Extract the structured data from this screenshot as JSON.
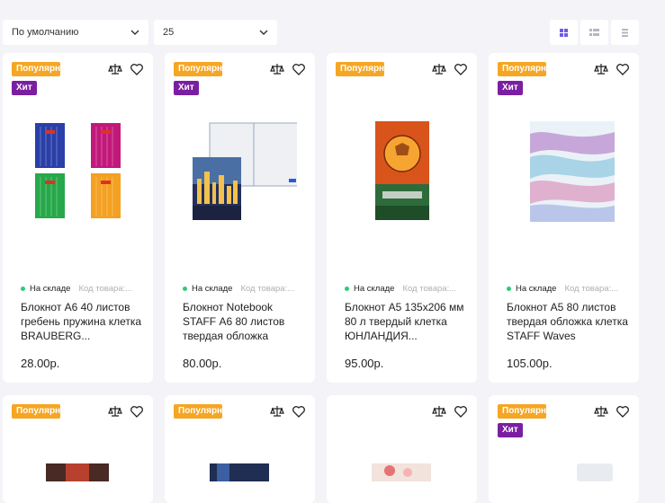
{
  "toolbar": {
    "sort_value": "По умолчанию",
    "perpage_value": "25"
  },
  "view_modes": [
    "grid-icon",
    "list-icon",
    "compact-list-icon"
  ],
  "colors": {
    "popular": "#f5a623",
    "hit": "#7b1fa2",
    "in_stock": "#2ecc71",
    "accent": "#6c5ce7"
  },
  "badges": {
    "popular": "Популярн...",
    "hit": "Хит"
  },
  "products": [
    {
      "stock": "На складе",
      "code": "Код товара:...",
      "name": "Блокнот А6 40 листов гребень пружина клетка BRAUBERG...",
      "price": "28.00р."
    },
    {
      "stock": "На складе",
      "code": "Код товара:...",
      "name": "Блокнот Notebook STAFF А6 80 листов твердая обложка",
      "price": "80.00р."
    },
    {
      "stock": "На складе",
      "code": "Код товара:...",
      "name": "Блокнот А5 135х206 мм 80 л твердый клетка ЮНЛАНДИЯ...",
      "price": "95.00р."
    },
    {
      "stock": "На складе",
      "code": "Код товара:...",
      "name": "Блокнот А5 80 листов твердая обложка клетка STAFF Waves",
      "price": "105.00р."
    }
  ]
}
